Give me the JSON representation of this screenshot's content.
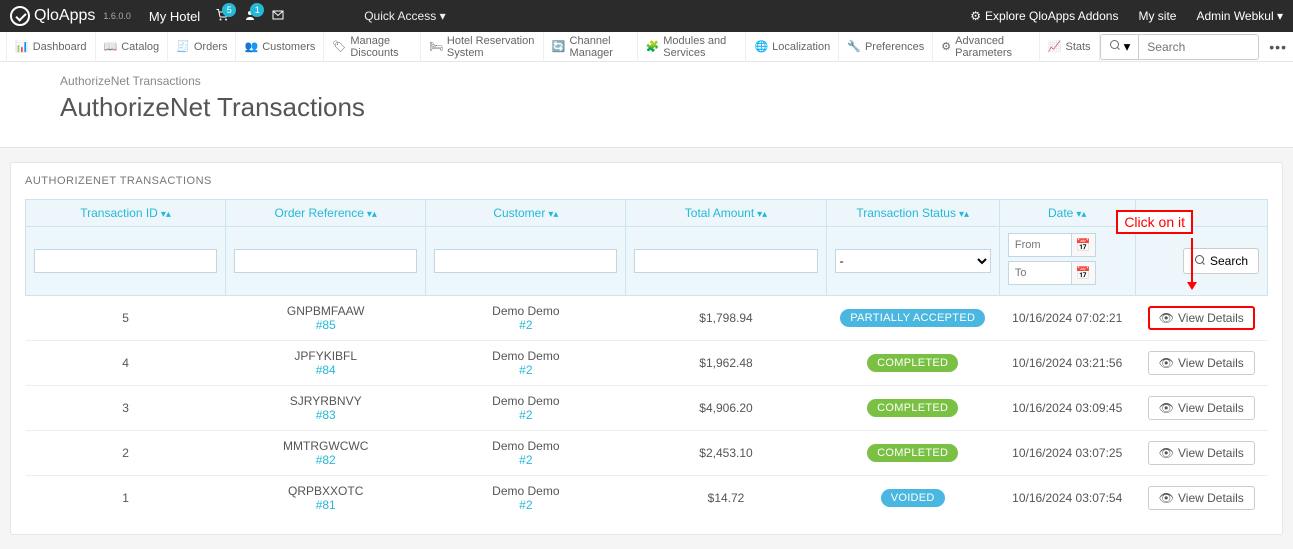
{
  "topbar": {
    "brand": "QloApps",
    "version": "1.6.0.0",
    "hotel": "My Hotel",
    "cart_badge": "5",
    "user_badge": "1",
    "quick_access": "Quick Access",
    "explore": "Explore QloApps Addons",
    "my_site": "My site",
    "admin": "Admin Webkul"
  },
  "menu": [
    "Dashboard",
    "Catalog",
    "Orders",
    "Customers",
    "Manage Discounts",
    "Hotel Reservation System",
    "Channel Manager",
    "Modules and Services",
    "Localization",
    "Preferences",
    "Advanced Parameters",
    "Stats"
  ],
  "search_placeholder": "Search",
  "breadcrumb": "AuthorizeNet Transactions",
  "page_title": "AuthorizeNet Transactions",
  "panel_title": "AUTHORIZENET TRANSACTIONS",
  "columns": [
    "Transaction ID",
    "Order Reference",
    "Customer",
    "Total Amount",
    "Transaction Status",
    "Date"
  ],
  "status_filter_default": "-",
  "date_from_ph": "From",
  "date_to_ph": "To",
  "search_label": "Search",
  "view_label": "View Details",
  "rows": [
    {
      "tx": "5",
      "ref": "GNPBMFAAW",
      "refnum": "#85",
      "cust": "Demo Demo",
      "cnum": "#2",
      "amount": "$1,798.94",
      "status": "PARTIALLY ACCEPTED",
      "stclass": "st-partial",
      "date": "10/16/2024 07:02:21",
      "hl": 1
    },
    {
      "tx": "4",
      "ref": "JPFYKIBFL",
      "refnum": "#84",
      "cust": "Demo Demo",
      "cnum": "#2",
      "amount": "$1,962.48",
      "status": "COMPLETED",
      "stclass": "st-completed",
      "date": "10/16/2024 03:21:56"
    },
    {
      "tx": "3",
      "ref": "SJRYRBNVY",
      "refnum": "#83",
      "cust": "Demo Demo",
      "cnum": "#2",
      "amount": "$4,906.20",
      "status": "COMPLETED",
      "stclass": "st-completed",
      "date": "10/16/2024 03:09:45"
    },
    {
      "tx": "2",
      "ref": "MMTRGWCWC",
      "refnum": "#82",
      "cust": "Demo Demo",
      "cnum": "#2",
      "amount": "$2,453.10",
      "status": "COMPLETED",
      "stclass": "st-completed",
      "date": "10/16/2024 03:07:25"
    },
    {
      "tx": "1",
      "ref": "QRPBXXOTC",
      "refnum": "#81",
      "cust": "Demo Demo",
      "cnum": "#2",
      "amount": "$14.72",
      "status": "VOIDED",
      "stclass": "st-voided",
      "date": "10/16/2024 03:07:54"
    }
  ],
  "annotation": "Click on it"
}
